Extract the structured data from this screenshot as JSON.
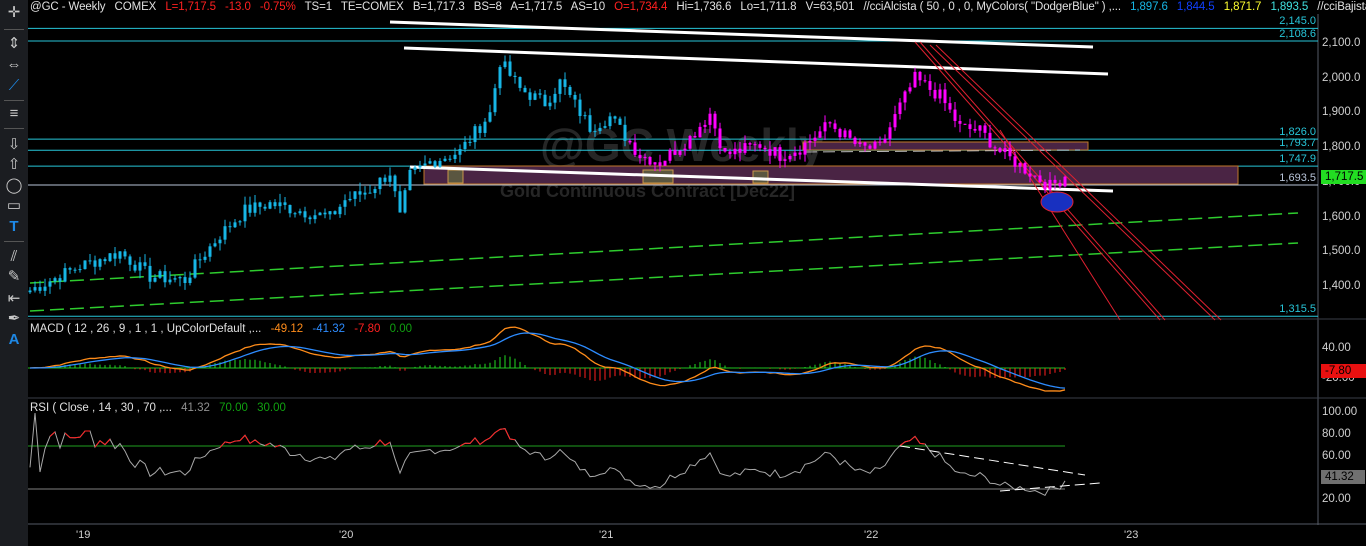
{
  "header": {
    "symbol": "@GC - Weekly",
    "exchange": "COMEX",
    "last": "L=1,717.5",
    "change": "-13.0",
    "change_pct": "-0.75%",
    "ts": "TS=1",
    "te": "TE=COMEX",
    "bid": "B=1,717.3",
    "bid_size": "BS=8",
    "ask": "A=1,717.5",
    "ask_size": "AS=10",
    "open": "O=1,734.4",
    "high": "Hi=1,736.6",
    "low": "Lo=1,711.8",
    "volume": "V=63,501",
    "cci_alcista": "//cciAlcista ( 50 , 0 , 0, MyColors( \"DodgerBlue\" ) ,...",
    "v1": "1,897.6",
    "v2": "1,844.5",
    "v3": "1,871.7",
    "v4": "1,893.5",
    "cci_bajista": "//cciBajista ( ..."
  },
  "watermark": {
    "title": "@GC Weekly",
    "subtitle": "Gold Continuous Contract [Dec22]"
  },
  "price_axis": [
    "2,100.0",
    "2,000.0",
    "1,900.0",
    "1,800.0",
    "1,700.0",
    "1,600.0",
    "1,500.0",
    "1,400.0"
  ],
  "price_axis_values": [
    2100,
    2000,
    1900,
    1800,
    1700,
    1600,
    1500,
    1400
  ],
  "levels": [
    {
      "label": "2,145.0",
      "value": 2145,
      "color": "#27c5d8"
    },
    {
      "label": "2,108.6",
      "value": 2108.6,
      "color": "#27c5d8"
    },
    {
      "label": "1,826.0",
      "value": 1826,
      "color": "#27c5d8"
    },
    {
      "label": "1,793.7",
      "value": 1793.7,
      "color": "#27c5d8"
    },
    {
      "label": "1,747.9",
      "value": 1747.9,
      "color": "#27c5d8"
    },
    {
      "label": "1,693.5",
      "value": 1693.5,
      "color": "#b8c4d8"
    },
    {
      "label": "1,315.5",
      "value": 1315.5,
      "color": "#27c5d8"
    }
  ],
  "last_price_tag": "1,717.5",
  "macd": {
    "label": "MACD ( 12 , 26 , 9 , 1 , 1 , UpColorDefault ,...",
    "macd": "-49.12",
    "signal": "-41.32",
    "diff": "-7.80",
    "zero": "0.00",
    "axis": [
      "40.00",
      "-20.00"
    ],
    "tag": "-7.80"
  },
  "rsi": {
    "label": "RSI ( Close , 14 , 30 , 70 ,...",
    "value": "41.32",
    "ob": "70.00",
    "os": "30.00",
    "axis": [
      "100.00",
      "80.00",
      "60.00",
      "20.00"
    ],
    "tag": "41.32"
  },
  "x_axis": [
    "'19",
    "'20",
    "'21",
    "'22",
    "'23"
  ],
  "colors": {
    "up": "#17b6e6",
    "down": "#ff00ff",
    "level": "#27c5d8",
    "macd": "#ff8c1a",
    "signal": "#2d8cff"
  },
  "chart_data": {
    "type": "candlestick",
    "price_path_week_price": [
      [
        0,
        1390
      ],
      [
        10,
        1460
      ],
      [
        18,
        1500
      ],
      [
        24,
        1430
      ],
      [
        31,
        1420
      ],
      [
        34,
        1480
      ],
      [
        38,
        1550
      ],
      [
        43,
        1620
      ],
      [
        48,
        1640
      ],
      [
        54,
        1620
      ],
      [
        60,
        1600
      ],
      [
        63,
        1650
      ],
      [
        68,
        1680
      ],
      [
        72,
        1730
      ],
      [
        74,
        1600
      ],
      [
        76,
        1720
      ],
      [
        80,
        1760
      ],
      [
        86,
        1790
      ],
      [
        92,
        1900
      ],
      [
        94,
        2050
      ],
      [
        98,
        1970
      ],
      [
        103,
        1930
      ],
      [
        106,
        1990
      ],
      [
        112,
        1860
      ],
      [
        116,
        1890
      ],
      [
        122,
        1780
      ],
      [
        126,
        1760
      ],
      [
        132,
        1830
      ],
      [
        136,
        1900
      ],
      [
        139,
        1780
      ],
      [
        146,
        1810
      ],
      [
        150,
        1780
      ],
      [
        154,
        1800
      ],
      [
        160,
        1870
      ],
      [
        166,
        1800
      ],
      [
        170,
        1800
      ],
      [
        174,
        1920
      ],
      [
        177,
        2000
      ],
      [
        182,
        1950
      ],
      [
        186,
        1860
      ],
      [
        190,
        1850
      ],
      [
        194,
        1790
      ],
      [
        200,
        1730
      ],
      [
        204,
        1690
      ],
      [
        207,
        1717.5
      ]
    ]
  }
}
